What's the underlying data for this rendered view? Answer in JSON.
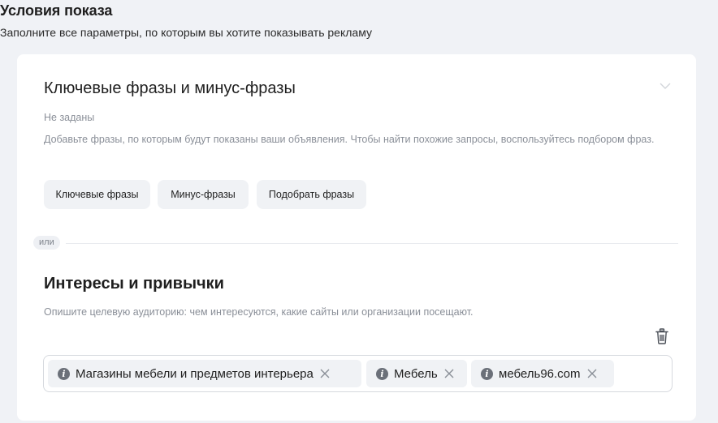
{
  "header": {
    "title": "Условия показа",
    "subtitle": "Заполните все параметры, по которым вы хотите показывать рекламу"
  },
  "keywords": {
    "title": "Ключевые фразы и минус-фразы",
    "status": "Не заданы",
    "description": "Добавьте фразы, по которым будут показаны ваши объявления. Чтобы найти похожие запросы, воспользуйтесь подбором фраз.",
    "buttons": {
      "keywords": "Ключевые фразы",
      "minus": "Минус-фразы",
      "pick": "Подобрать фразы"
    }
  },
  "divider": {
    "label": "или"
  },
  "interests": {
    "title": "Интересы и привычки",
    "description": "Опишите целевую аудиторию: чем интересуются, какие сайты или организации посещают.",
    "tags": [
      {
        "label": "Магазины мебели и предметов интерьера"
      },
      {
        "label": "Мебель"
      },
      {
        "label": "мебель96.com"
      }
    ]
  },
  "icons": {
    "chevron": "chevron-down-icon",
    "trash": "trash-icon",
    "info": "info-icon",
    "remove": "close-icon"
  },
  "colors": {
    "page_background": "#f0f2f6",
    "card_background": "#ffffff",
    "chip_background": "#f0f2f5",
    "muted_text": "#8a8f98"
  }
}
